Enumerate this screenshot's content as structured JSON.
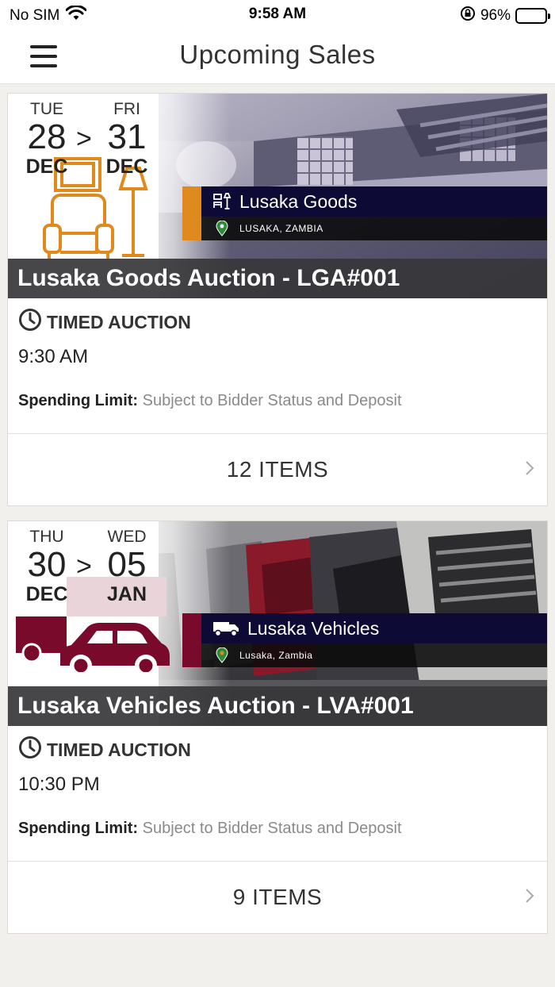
{
  "status_bar": {
    "carrier": "No SIM",
    "time": "9:58 AM",
    "battery_percent": "96%",
    "battery_level": 0.96
  },
  "nav": {
    "title": "Upcoming Sales",
    "menu_icon": "hamburger-menu-icon"
  },
  "sales": [
    {
      "start": {
        "dow": "TUE",
        "day": "28",
        "month": "DEC"
      },
      "end": {
        "dow": "FRI",
        "day": "31",
        "month": "DEC"
      },
      "arrow": ">",
      "brand_name": "Lusaka Goods",
      "brand_location": "LUSAKA, ZAMBIA",
      "accent_color": "#e08a1e",
      "title": "Lusaka Goods Auction - LGA#001",
      "auction_type": "TIMED AUCTION",
      "time": "9:30 AM",
      "spending_label": "Spending Limit:",
      "spending_value": "Subject to Bidder Status and Deposit",
      "items": "12 ITEMS"
    },
    {
      "start": {
        "dow": "THU",
        "day": "30",
        "month": "DEC"
      },
      "end": {
        "dow": "WED",
        "day": "05",
        "month": "JAN"
      },
      "arrow": ">",
      "brand_name": "Lusaka Vehicles",
      "brand_location": "Lusaka, Zambia",
      "accent_color": "#7a0a2c",
      "title": "Lusaka Vehicles Auction - LVA#001",
      "auction_type": "TIMED AUCTION",
      "time": "10:30 PM",
      "spending_label": "Spending Limit:",
      "spending_value": "Subject to Bidder Status and Deposit",
      "items": "9 ITEMS"
    }
  ]
}
